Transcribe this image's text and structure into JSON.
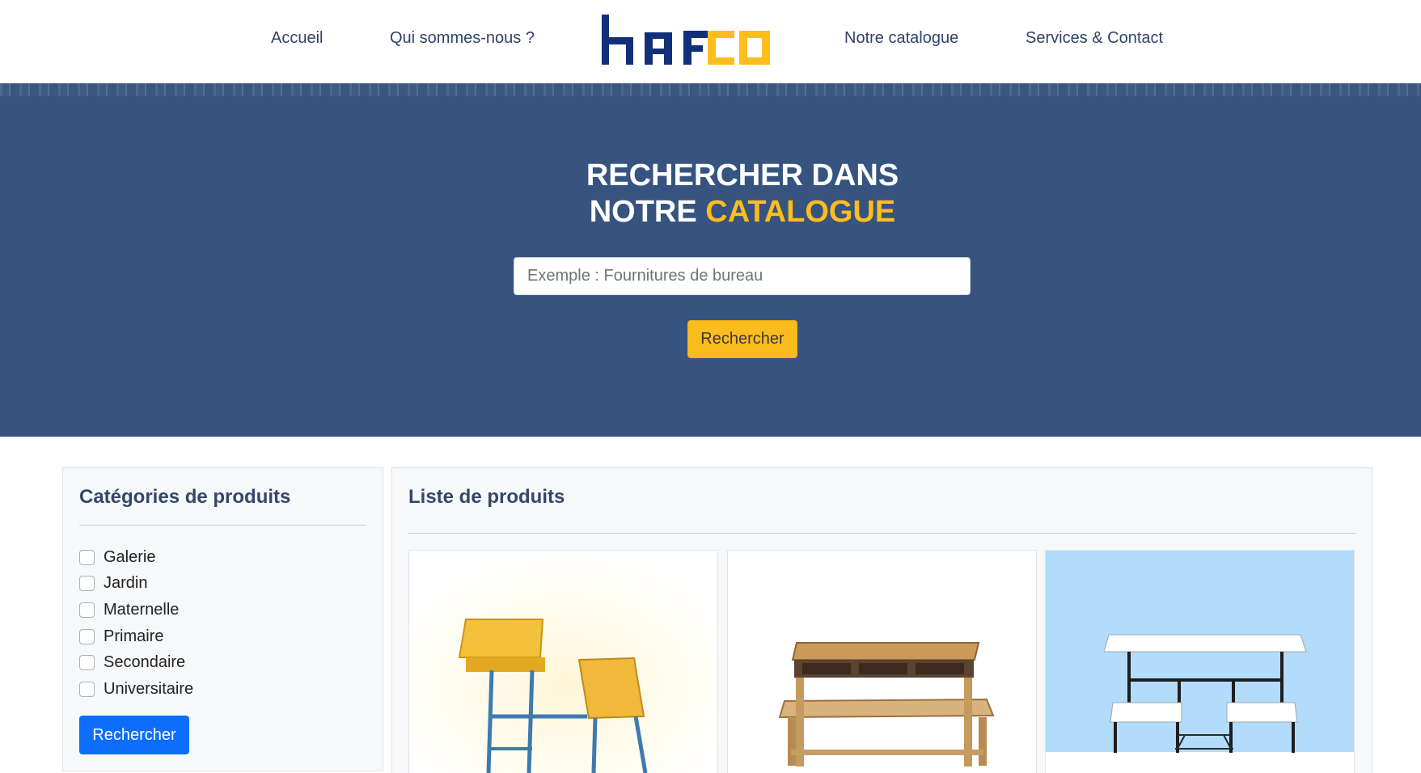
{
  "nav": {
    "home": "Accueil",
    "about": "Qui sommes-nous ?",
    "catalogue": "Notre catalogue",
    "contact": "Services & Contact"
  },
  "logo": {
    "text": "hafco",
    "colors": {
      "navy": "#12307a",
      "yellow": "#fdbd1d"
    },
    "icon": "hafco-logo"
  },
  "hero": {
    "title_line1": "RECHERCHER DANS",
    "title_line2_prefix": "NOTRE ",
    "title_line2_accent": "CATALOGUE",
    "search_placeholder": "Exemple : Fournitures de bureau",
    "search_value": "",
    "search_button": "Rechercher"
  },
  "sidebar": {
    "title": "Catégories de produits",
    "categories": [
      {
        "label": "Galerie",
        "checked": false
      },
      {
        "label": "Jardin",
        "checked": false
      },
      {
        "label": "Maternelle",
        "checked": false
      },
      {
        "label": "Primaire",
        "checked": false
      },
      {
        "label": "Secondaire",
        "checked": false
      },
      {
        "label": "Universitaire",
        "checked": false
      }
    ],
    "button": "Rechercher"
  },
  "products": {
    "title": "Liste de produits",
    "items": [
      {
        "image": "yellow-wooden-school-desk-with-blue-frame"
      },
      {
        "image": "natural-wood-school-desk-with-bench"
      },
      {
        "image": "white-top-school-desk-black-metal-frame"
      }
    ]
  },
  "colors": {
    "navy_bg": "#36547f",
    "accent_yellow": "#fdbd1d",
    "primary_blue": "#0d6efd",
    "text": "#33476b"
  }
}
